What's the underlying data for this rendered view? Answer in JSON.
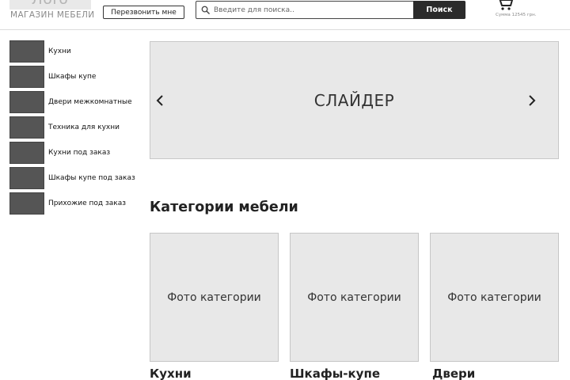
{
  "header": {
    "logo_text": "Лого",
    "shop_name": "МАГАЗИН МЕБЕЛИ",
    "callback_label": "Перезвонить мне",
    "search": {
      "placeholder": "Введите для поиска..",
      "button_label": "Поиск"
    },
    "cart": {
      "icon": "shopping-cart-icon",
      "sum_text": "Сумма 12545 грн."
    }
  },
  "sidebar": {
    "items": [
      {
        "label": "Кухни"
      },
      {
        "label": "Шкафы купе"
      },
      {
        "label": "Двери межкомнатные"
      },
      {
        "label": "Техника для кухни"
      },
      {
        "label": "Кухни под заказ"
      },
      {
        "label": "Шкафы купе под заказ"
      },
      {
        "label": "Прихожие под заказ"
      }
    ]
  },
  "slider": {
    "label": "СЛАЙДЕР",
    "prev_icon": "chevron-left-icon",
    "next_icon": "chevron-right-icon"
  },
  "categories": {
    "title": "Категории мебели",
    "items": [
      {
        "photo_label": "Фото категории",
        "name": "Кухни"
      },
      {
        "photo_label": "Фото категории",
        "name": "Шкафы-купе"
      },
      {
        "photo_label": "Фото категории",
        "name": "Двери"
      }
    ]
  },
  "colors": {
    "accent_dark": "#2b2b2b",
    "placeholder_gray": "#e8e8e8",
    "thumb_gray": "#555555"
  }
}
